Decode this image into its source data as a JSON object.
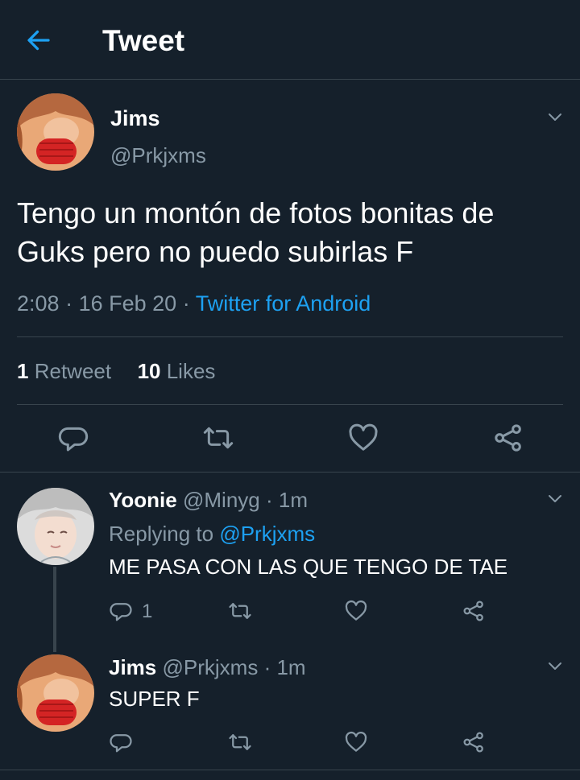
{
  "header": {
    "title": "Tweet",
    "back_icon": "arrow-left-icon"
  },
  "colors": {
    "background": "#15202b",
    "accent": "#1da1f2",
    "muted": "#8899a6",
    "divider": "#38444d"
  },
  "main_tweet": {
    "name": "Jims",
    "handle": "@Prkjxms",
    "text": "Tengo un montón de fotos bonitas de Guks pero no puedo subirlas F",
    "time": "2:08",
    "date": "16 Feb 20",
    "source": "Twitter for Android",
    "retweet_count": "1",
    "retweet_label": "Retweet",
    "like_count": "10",
    "like_label": "Likes",
    "actions": [
      "reply-icon",
      "retweet-icon",
      "like-icon",
      "share-icon"
    ]
  },
  "replies": [
    {
      "name": "Yoonie",
      "handle": "@Minyg",
      "time": "1m",
      "replying_prefix": "Replying to",
      "replying_to": "@Prkjxms",
      "text": "ME PASA CON LAS QUE TENGO DE TAE",
      "reply_count": "1"
    },
    {
      "name": "Jims",
      "handle": "@Prkjxms",
      "time": "1m",
      "text": "SUPER F",
      "reply_count": ""
    }
  ]
}
